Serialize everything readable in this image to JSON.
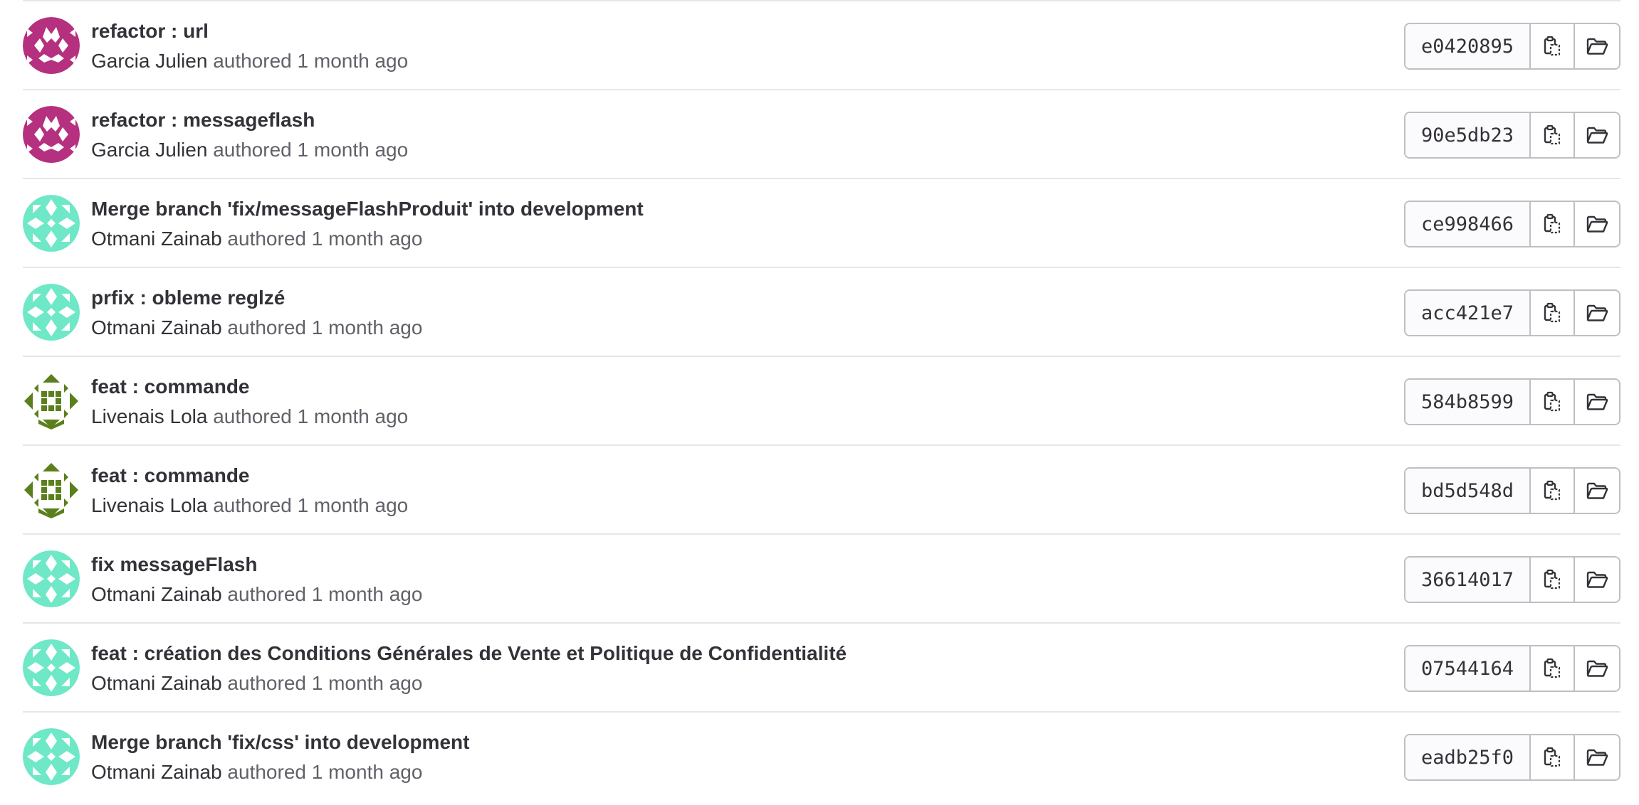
{
  "commits": [
    {
      "title": "refactor : url",
      "author": "Garcia Julien",
      "authored_label": "authored",
      "time": "1 month ago",
      "sha": "e0420895",
      "avatar": "pink-flower",
      "avatar_color": "#b5307f"
    },
    {
      "title": "refactor : messageflash",
      "author": "Garcia Julien",
      "authored_label": "authored",
      "time": "1 month ago",
      "sha": "90e5db23",
      "avatar": "pink-flower",
      "avatar_color": "#b5307f"
    },
    {
      "title": "Merge branch 'fix/messageFlashProduit' into development",
      "author": "Otmani Zainab",
      "authored_label": "authored",
      "time": "1 month ago",
      "sha": "ce998466",
      "avatar": "mint-pattern",
      "avatar_color": "#6ee8c6"
    },
    {
      "title": "prfix : obleme reglzé",
      "author": "Otmani Zainab",
      "authored_label": "authored",
      "time": "1 month ago",
      "sha": "acc421e7",
      "avatar": "mint-pattern",
      "avatar_color": "#6ee8c6"
    },
    {
      "title": "feat : commande",
      "author": "Livenais Lola",
      "authored_label": "authored",
      "time": "1 month ago",
      "sha": "584b8599",
      "avatar": "olive-diamond",
      "avatar_color": "#5a7f1c"
    },
    {
      "title": "feat : commande",
      "author": "Livenais Lola",
      "authored_label": "authored",
      "time": "1 month ago",
      "sha": "bd5d548d",
      "avatar": "olive-diamond",
      "avatar_color": "#5a7f1c"
    },
    {
      "title": "fix messageFlash",
      "author": "Otmani Zainab",
      "authored_label": "authored",
      "time": "1 month ago",
      "sha": "36614017",
      "avatar": "mint-pattern",
      "avatar_color": "#6ee8c6"
    },
    {
      "title": "feat : création des Conditions Générales de Vente et Politique de Confidentialité",
      "author": "Otmani Zainab",
      "authored_label": "authored",
      "time": "1 month ago",
      "sha": "07544164",
      "avatar": "mint-pattern",
      "avatar_color": "#6ee8c6"
    },
    {
      "title": "Merge branch 'fix/css' into development",
      "author": "Otmani Zainab",
      "authored_label": "authored",
      "time": "1 month ago",
      "sha": "eadb25f0",
      "avatar": "mint-pattern",
      "avatar_color": "#6ee8c6"
    }
  ],
  "icons": {
    "copy": "clipboard-icon",
    "browse": "folder-icon"
  },
  "colors": {
    "text": "#333238",
    "muted": "#626168",
    "border": "#bfbfc3",
    "divider": "#e6e6ea"
  }
}
